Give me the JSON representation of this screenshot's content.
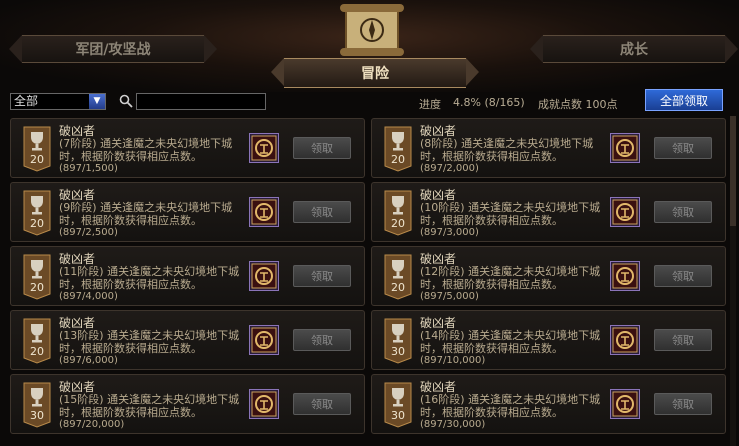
{
  "tabs": {
    "left": "军团/攻坚战",
    "active": "冒险",
    "right": "成长"
  },
  "toolbar": {
    "filter_value": "全部",
    "search_value": "",
    "progress_label": "进度",
    "progress_value": "4.8% (8/165)",
    "points_label": "成就点数 100点",
    "claim_all_label": "全部领取"
  },
  "colors": {
    "accent_blue": "#2f6ad8",
    "gold": "#c9a05a",
    "text": "#c9b99a"
  },
  "achievements": [
    {
      "title": "破凶者",
      "desc": "(7阶段) 通关逢魔之未央幻境地下城时，根据阶数获得相应点数。",
      "progress": "(897/1,500)",
      "points": "20",
      "claim": "领取"
    },
    {
      "title": "破凶者",
      "desc": "(8阶段) 通关逢魔之未央幻境地下城时，根据阶数获得相应点数。",
      "progress": "(897/2,000)",
      "points": "20",
      "claim": "领取"
    },
    {
      "title": "破凶者",
      "desc": "(9阶段) 通关逢魔之未央幻境地下城时，根据阶数获得相应点数。",
      "progress": "(897/2,500)",
      "points": "20",
      "claim": "领取"
    },
    {
      "title": "破凶者",
      "desc": "(10阶段) 通关逢魔之未央幻境地下城时，根据阶数获得相应点数。",
      "progress": "(897/3,000)",
      "points": "20",
      "claim": "领取"
    },
    {
      "title": "破凶者",
      "desc": "(11阶段) 通关逢魔之未央幻境地下城时，根据阶数获得相应点数。",
      "progress": "(897/4,000)",
      "points": "20",
      "claim": "领取"
    },
    {
      "title": "破凶者",
      "desc": "(12阶段) 通关逢魔之未央幻境地下城时，根据阶数获得相应点数。",
      "progress": "(897/5,000)",
      "points": "20",
      "claim": "领取"
    },
    {
      "title": "破凶者",
      "desc": "(13阶段) 通关逢魔之未央幻境地下城时，根据阶数获得相应点数。",
      "progress": "(897/6,000)",
      "points": "20",
      "claim": "领取"
    },
    {
      "title": "破凶者",
      "desc": "(14阶段) 通关逢魔之未央幻境地下城时，根据阶数获得相应点数。",
      "progress": "(897/10,000)",
      "points": "30",
      "claim": "领取"
    },
    {
      "title": "破凶者",
      "desc": "(15阶段) 通关逢魔之未央幻境地下城时，根据阶数获得相应点数。",
      "progress": "(897/20,000)",
      "points": "30",
      "claim": "领取"
    },
    {
      "title": "破凶者",
      "desc": "(16阶段) 通关逢魔之未央幻境地下城时，根据阶数获得相应点数。",
      "progress": "(897/30,000)",
      "points": "30",
      "claim": "领取"
    }
  ]
}
